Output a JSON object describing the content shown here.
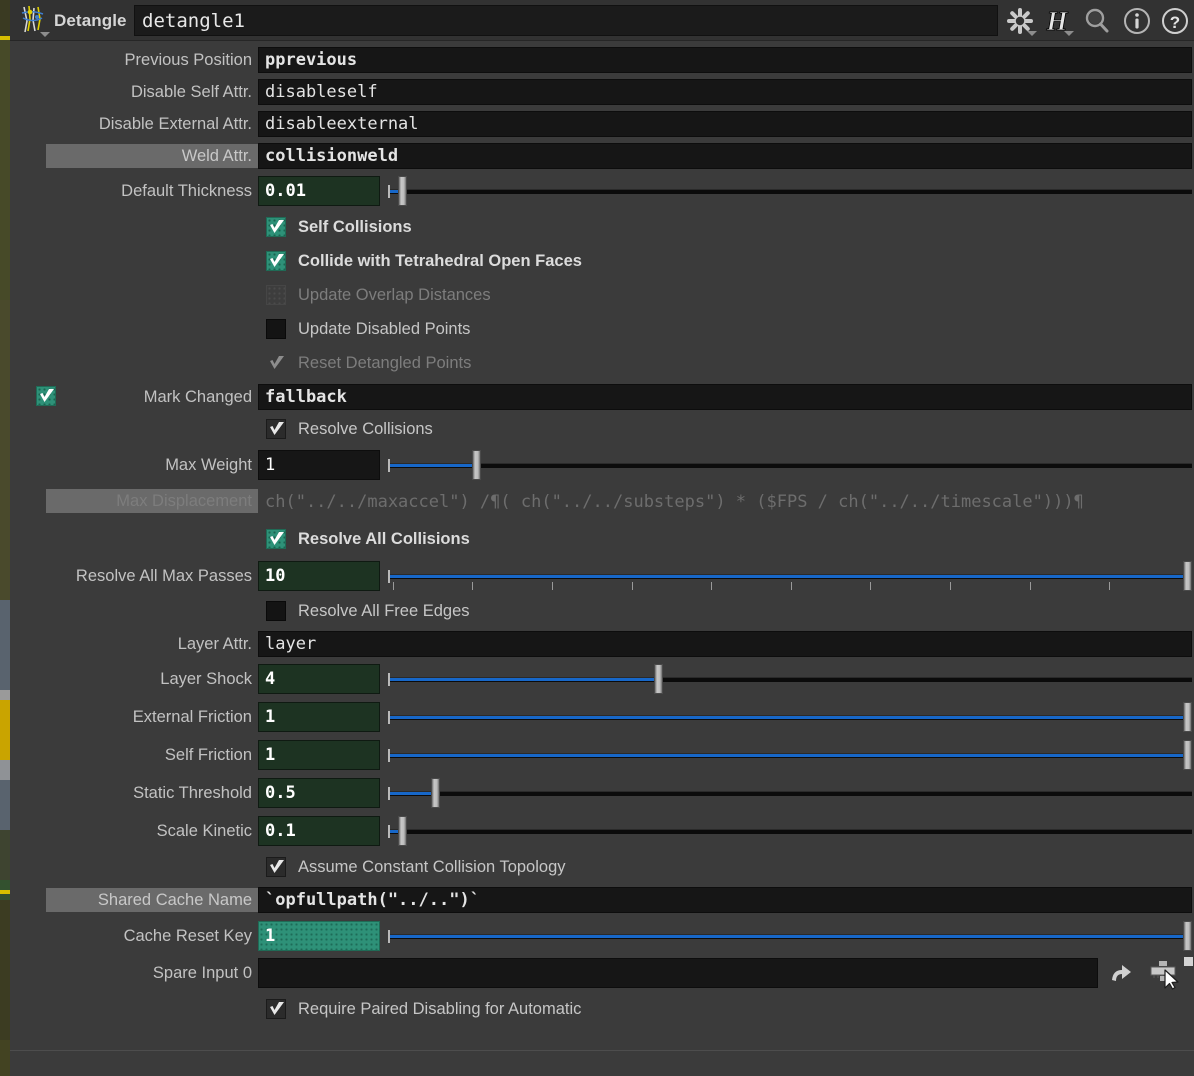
{
  "header": {
    "node_type_label": "Detangle",
    "node_name": "detangle1",
    "icons": [
      {
        "name": "gear-icon",
        "has_caret": true
      },
      {
        "name": "houdini-h-icon",
        "has_caret": true
      },
      {
        "name": "search-icon",
        "has_caret": false
      },
      {
        "name": "info-icon",
        "has_caret": false
      },
      {
        "name": "help-icon",
        "has_caret": false
      }
    ]
  },
  "parameters": [
    {
      "id": "pprevious",
      "label": "Previous Position",
      "type": "string",
      "value": "pprevious",
      "bold": true
    },
    {
      "id": "disableself",
      "label": "Disable Self Attr.",
      "type": "string",
      "value": "disableself",
      "bold": false
    },
    {
      "id": "disableexternal",
      "label": "Disable External Attr.",
      "type": "string",
      "value": "disableexternal",
      "bold": false
    },
    {
      "id": "collisionweld",
      "label": "Weld Attr.",
      "type": "string",
      "value": "collisionweld",
      "bold": true,
      "label_highlight": true
    },
    {
      "id": "thickness",
      "label": "Default Thickness",
      "type": "number",
      "value": "0.01",
      "slider_pct": 1.7,
      "fill_pct": 1.2
    },
    {
      "id": "selfcollisions",
      "label": "Self Collisions",
      "type": "toggle",
      "checked": true,
      "style": "teal",
      "bold": true
    },
    {
      "id": "tetopenfaces",
      "label": "Collide with Tetrahedral Open Faces",
      "type": "toggle",
      "checked": true,
      "style": "teal",
      "bold": true
    },
    {
      "id": "updateoverlap",
      "label": "Update Overlap Distances",
      "type": "toggle",
      "checked": false,
      "style": "ghost",
      "disabled": true
    },
    {
      "id": "updatedisabled",
      "label": "Update Disabled Points",
      "type": "toggle",
      "checked": false,
      "style": "dark"
    },
    {
      "id": "resetdetangled",
      "label": "Reset Detangled Points",
      "type": "toggle",
      "checked": true,
      "style": "flat",
      "disabled": true
    },
    {
      "id": "markchanged",
      "label": "Mark Changed",
      "type": "string_with_toggle",
      "value": "fallback",
      "bold": true,
      "checked": true
    },
    {
      "id": "resolvecollisions",
      "label": "Resolve Collisions",
      "type": "toggle",
      "checked": true,
      "style": "dark-check"
    },
    {
      "id": "maxweight",
      "label": "Max Weight",
      "type": "number",
      "value": "1",
      "slider_pct": 11.0,
      "fill_pct": 11.0,
      "plain": true
    },
    {
      "id": "maxdisplacement",
      "label": "Max Displacement",
      "type": "expression",
      "value": "ch(\"../../maxaccel\") /¶( ch(\"../../substeps\") * ($FPS / ch(\"../../timescale\")))¶",
      "label_highlight": true,
      "disabled": true,
      "checked": true,
      "style": "teal-nocheck"
    },
    {
      "id": "resolveall",
      "label": "Resolve All Collisions",
      "type": "toggle",
      "checked": true,
      "style": "teal",
      "bold": true
    },
    {
      "id": "resolveallpasses",
      "label": "Resolve All Max Passes",
      "type": "number",
      "value": "10",
      "slider_pct": 99.4,
      "fill_pct": 99.4,
      "ticks": 10
    },
    {
      "id": "resolveallfree",
      "label": "Resolve All Free Edges",
      "type": "toggle",
      "checked": false,
      "style": "dark"
    },
    {
      "id": "layerattr",
      "label": "Layer Attr.",
      "type": "string",
      "value": "layer",
      "bold": false
    },
    {
      "id": "layershock",
      "label": "Layer Shock",
      "type": "number",
      "value": "4",
      "slider_pct": 33.6,
      "fill_pct": 33.6
    },
    {
      "id": "extfriction",
      "label": "External Friction",
      "type": "number",
      "value": "1",
      "slider_pct": 99.4,
      "fill_pct": 99.4
    },
    {
      "id": "selffriction",
      "label": "Self Friction",
      "type": "number",
      "value": "1",
      "slider_pct": 99.4,
      "fill_pct": 99.4
    },
    {
      "id": "staticthreshold",
      "label": "Static Threshold",
      "type": "number",
      "value": "0.5",
      "slider_pct": 5.9,
      "fill_pct": 5.2
    },
    {
      "id": "scalekinetic",
      "label": "Scale Kinetic",
      "type": "number",
      "value": "0.1",
      "slider_pct": 1.7,
      "fill_pct": 1.2
    },
    {
      "id": "constanttopology",
      "label": "Assume Constant Collision Topology",
      "type": "toggle",
      "checked": true,
      "style": "dark-check"
    },
    {
      "id": "sharedcachename",
      "label": "Shared Cache Name",
      "type": "string",
      "value": "`opfullpath(\"../..\")`",
      "bold": true,
      "label_highlight": true
    },
    {
      "id": "cacheresetkey",
      "label": "Cache Reset Key",
      "type": "number",
      "value": "1",
      "slider_pct": 99.4,
      "fill_pct": 99.4,
      "keyed": true
    },
    {
      "id": "spareinput0",
      "label": "Spare Input 0",
      "type": "oppath",
      "value": "",
      "icons": [
        "reload-icon",
        "op-chooser-icon"
      ]
    },
    {
      "id": "pairdisabling",
      "label": "Require Paired Disabling for Automatic",
      "type": "toggle",
      "checked": true,
      "style": "dark-check"
    }
  ],
  "colors": {
    "panel_bg": "#3b3b3b",
    "field_bg": "#161616",
    "num_bg": "#1d3322",
    "teal": "#2e9178",
    "slider_blue": "#1767c8",
    "label_text": "#c2c2c2",
    "label_highlight_bg": "#6a6a6a"
  }
}
